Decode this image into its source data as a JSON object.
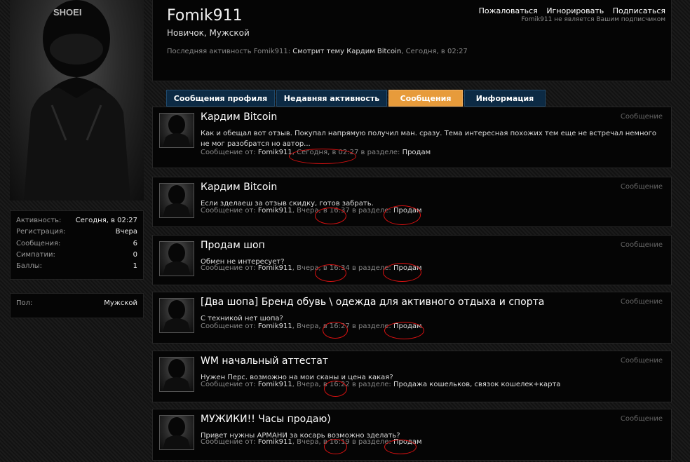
{
  "sidebar": {
    "stats": [
      {
        "label": "Активность:",
        "value": "Сегодня, в 02:27"
      },
      {
        "label": "Регистрация:",
        "value": "Вчера"
      },
      {
        "label": "Сообщения:",
        "value": "6"
      },
      {
        "label": "Симпатии:",
        "value": "0"
      },
      {
        "label": "Баллы:",
        "value": "1"
      }
    ],
    "info": [
      {
        "label": "Пол:",
        "value": "Мужской"
      }
    ]
  },
  "header": {
    "username": "Fomik911",
    "subtitle": "Новичок, Мужской",
    "activity_prefix": "Последняя активность Fomik911:",
    "activity_action": "Смотрит тему",
    "activity_thread": "Кардим Bitcoin",
    "activity_time": ", Сегодня, в 02:27",
    "links": {
      "report": "Пожаловаться",
      "ignore": "Игнорировать",
      "subscribe": "Подписаться"
    },
    "note": "Fomik911 не является Вашим подписчиком"
  },
  "tabs": [
    {
      "label": "Сообщения профиля"
    },
    {
      "label": "Недавняя активность"
    },
    {
      "label": "Сообщения",
      "active": true
    },
    {
      "label": "Информация"
    }
  ],
  "posts": [
    {
      "title": "Кардим Bitcoin",
      "type": "Сообщение",
      "snippet": "Как и обещал вот отзыв. Покупал напрямую получил ман. сразу. Тема интересная похожих тем еще не встречал немного не мог разобратся но автор...",
      "meta_prefix": "Сообщение от:",
      "author": "Fomik911",
      "time": ", Сегодня, в 02:27",
      "section_prefix": " в разделе:",
      "section": "Продам"
    },
    {
      "title": "Кардим Bitcoin",
      "type": "Сообщение",
      "snippet": "Если зделаеш за отзыв скидку, готов забрать.",
      "meta_prefix": "Сообщение от:",
      "author": "Fomik911",
      "time": ", Вчера, в 16:37",
      "section_prefix": " в разделе:",
      "section": "Продам"
    },
    {
      "title": "Продам шоп",
      "type": "Сообщение",
      "snippet": "Обмен не интересует?",
      "meta_prefix": "Сообщение от:",
      "author": "Fomik911",
      "time": ", Вчера, в 16:34",
      "section_prefix": " в разделе:",
      "section": "Продам"
    },
    {
      "title": "[Два шопа] Бренд обувь \\ одежда для активного отдыха и спорта",
      "type": "Сообщение",
      "snippet": "С техникой нет шопа?",
      "meta_prefix": "Сообщение от:",
      "author": "Fomik911",
      "time": ", Вчера, в 16:27",
      "section_prefix": " в разделе:",
      "section": "Продам"
    },
    {
      "title": "WM начальный аттестат",
      "type": "Сообщение",
      "snippet": "Нужен Перс. возможно на мои сканы и цена какая?",
      "meta_prefix": "Сообщение от:",
      "author": "Fomik911",
      "time": ", Вчера, в 16:22",
      "section_prefix": " в разделе:",
      "section": "Продажа кошельков, связок кошелек+карта"
    },
    {
      "title": "МУЖИКИ!! Часы продаю)",
      "type": "Сообщение",
      "snippet": "Привет нужны АРМАНИ за косарь возможно зделать?",
      "meta_prefix": "Сообщение от:",
      "author": "Fomik911",
      "time": ", Вчера, в 16:19",
      "section_prefix": " в разделе:",
      "section": "Продам"
    }
  ]
}
